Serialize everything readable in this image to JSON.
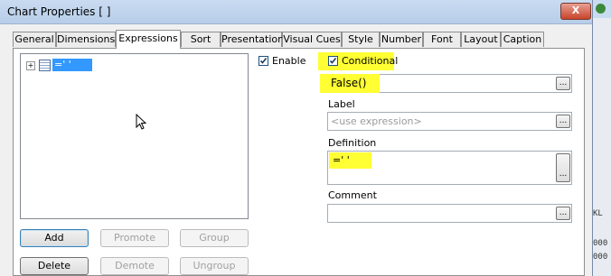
{
  "window": {
    "title": "Chart Properties [ ]",
    "close_symbol": "X"
  },
  "tabs": [
    {
      "label": "General",
      "active": false
    },
    {
      "label": "Dimensions",
      "active": false
    },
    {
      "label": "Expressions",
      "active": true
    },
    {
      "label": "Sort",
      "active": false
    },
    {
      "label": "Presentation",
      "active": false
    },
    {
      "label": "Visual Cues",
      "active": false
    },
    {
      "label": "Style",
      "active": false
    },
    {
      "label": "Number",
      "active": false
    },
    {
      "label": "Font",
      "active": false
    },
    {
      "label": "Layout",
      "active": false
    },
    {
      "label": "Caption",
      "active": false
    }
  ],
  "expressions_tree": {
    "expander": "+",
    "item_label": "=' '"
  },
  "buttons": {
    "add": "Add",
    "promote": "Promote",
    "group": "Group",
    "delete": "Delete",
    "demote": "Demote",
    "ungroup": "Ungroup"
  },
  "enable": {
    "label": "Enable",
    "checked": true
  },
  "conditional": {
    "label": "Conditional",
    "checked": true,
    "expression": "False()"
  },
  "label_field": {
    "label": "Label",
    "placeholder": "<use expression>"
  },
  "definition_field": {
    "label": "Definition",
    "value": "=' '"
  },
  "comment_field": {
    "label": "Comment",
    "value": ""
  },
  "ellipsis_label": "...",
  "background_strip": {
    "text_1": "KL",
    "text_2": "000",
    "text_3": "000"
  },
  "colors": {
    "highlight": "#ffff33",
    "selection": "#3399ff",
    "close": "#c7432b"
  }
}
